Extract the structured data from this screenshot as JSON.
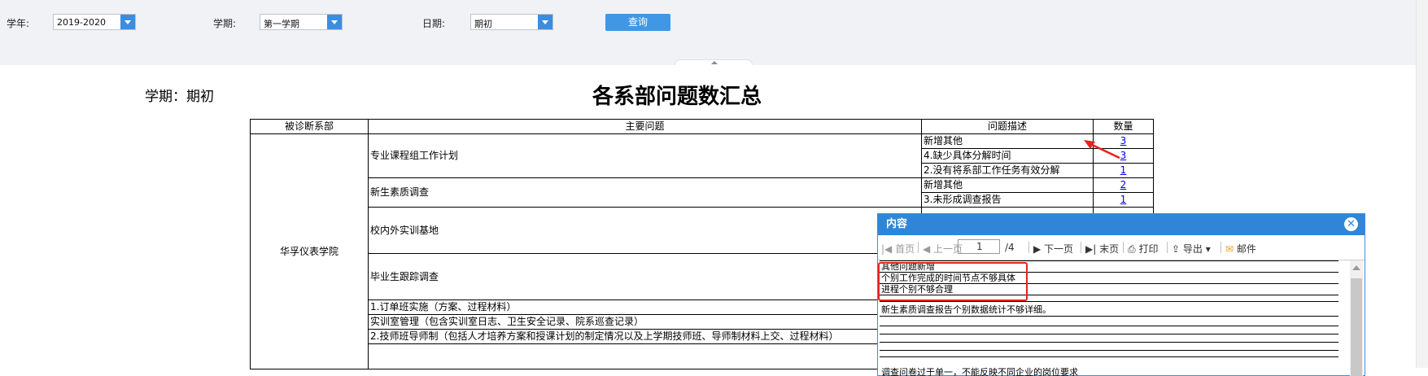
{
  "filters": {
    "year_label": "学年:",
    "year_value": "2019-2020",
    "semester_label": "学期:",
    "semester_value": "第一学期",
    "date_label": "日期:",
    "date_value": "期初",
    "query_button": "查询"
  },
  "report": {
    "term_label": "学期：期初",
    "title": "各系部问题数汇总",
    "headers": [
      "被诊断系部",
      "主要问题",
      "问题描述",
      "数量"
    ],
    "department": "华孚仪表学院",
    "groups": [
      {
        "issue": "专业课程组工作计划",
        "rows": [
          {
            "desc": "新增其他",
            "count": "3"
          },
          {
            "desc": "4.缺少具体分解时间",
            "count": "3"
          },
          {
            "desc": "2.没有将系部工作任务有效分解",
            "count": "1"
          }
        ]
      },
      {
        "issue": "新生素质调查",
        "rows": [
          {
            "desc": "新增其他",
            "count": "2"
          },
          {
            "desc": "3.未形成调查报告",
            "count": "1"
          }
        ]
      },
      {
        "issue": "校内外实训基地",
        "rows": []
      },
      {
        "issue": "毕业生跟踪调查",
        "rows": []
      },
      {
        "issue": "1.订单班实施（方案、过程材料）",
        "rows": []
      },
      {
        "issue": "实训室管理（包含实训室日志、卫生安全记录、院系巡查记录）",
        "rows": []
      },
      {
        "issue": "2.技师班导师制（包括人才培养方案和授课计划的制定情况以及上学期技师班、导师制材料上交、过程材料）",
        "rows": []
      }
    ]
  },
  "popup": {
    "title": "内容",
    "close_icon": "close-circle-icon",
    "toolbar": {
      "first": "首页",
      "prev": "上一页",
      "page_value": "1",
      "page_total": "/4",
      "next": "下一页",
      "last": "末页",
      "print": "打印",
      "export": "导出",
      "mail": "邮件"
    },
    "lines": [
      "其他问题新增",
      "个别工作完成的时间节点不够具体",
      "进程个别不够合理",
      "新生素质调查报告个别数据统计不够详细。",
      "调查问卷过于单一，不能反映不同企业的岗位要求"
    ]
  },
  "colors": {
    "accent": "#2f86d8",
    "button": "#3f97e6",
    "highlight": "#e8221e"
  }
}
